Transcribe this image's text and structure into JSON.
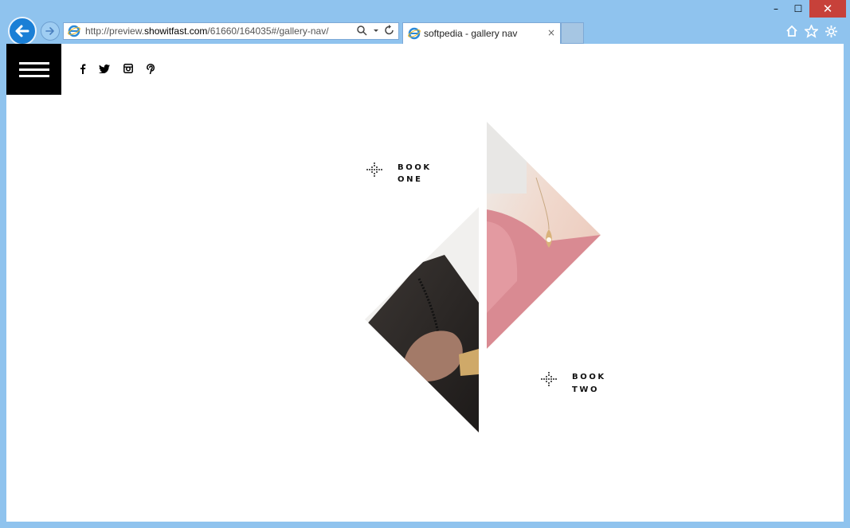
{
  "browser": {
    "address_url_prefix": "http://preview.",
    "address_url_domain": "showitfast.com",
    "address_url_rest": "/61660/164035#/gallery-nav/",
    "tab_title": "softpedia - gallery nav",
    "tab_close": "×",
    "window_minimize": "–",
    "window_maximize": "☐",
    "window_close": "✕",
    "icons": [
      "back-arrow-icon",
      "forward-arrow-icon",
      "ie-logo-icon",
      "search-icon",
      "refresh-icon",
      "home-icon",
      "favorites-star-icon",
      "settings-gear-icon"
    ]
  },
  "site": {
    "social": [
      {
        "name": "facebook-icon",
        "glyph": "f"
      },
      {
        "name": "twitter-icon",
        "glyph": "🐦"
      },
      {
        "name": "instagram-icon",
        "glyph": "◘"
      },
      {
        "name": "pinterest-icon",
        "glyph": "𝒑"
      }
    ],
    "books": [
      {
        "line1": "BOOK",
        "line2": "ONE"
      },
      {
        "line1": "BOOK",
        "line2": "TWO"
      }
    ]
  },
  "colors": {
    "chrome": "#8fc3ee",
    "back_button": "#1a7fd6",
    "close_button": "#c7413a",
    "menu_bg": "#000000",
    "photo_pink": "#d88a90"
  }
}
